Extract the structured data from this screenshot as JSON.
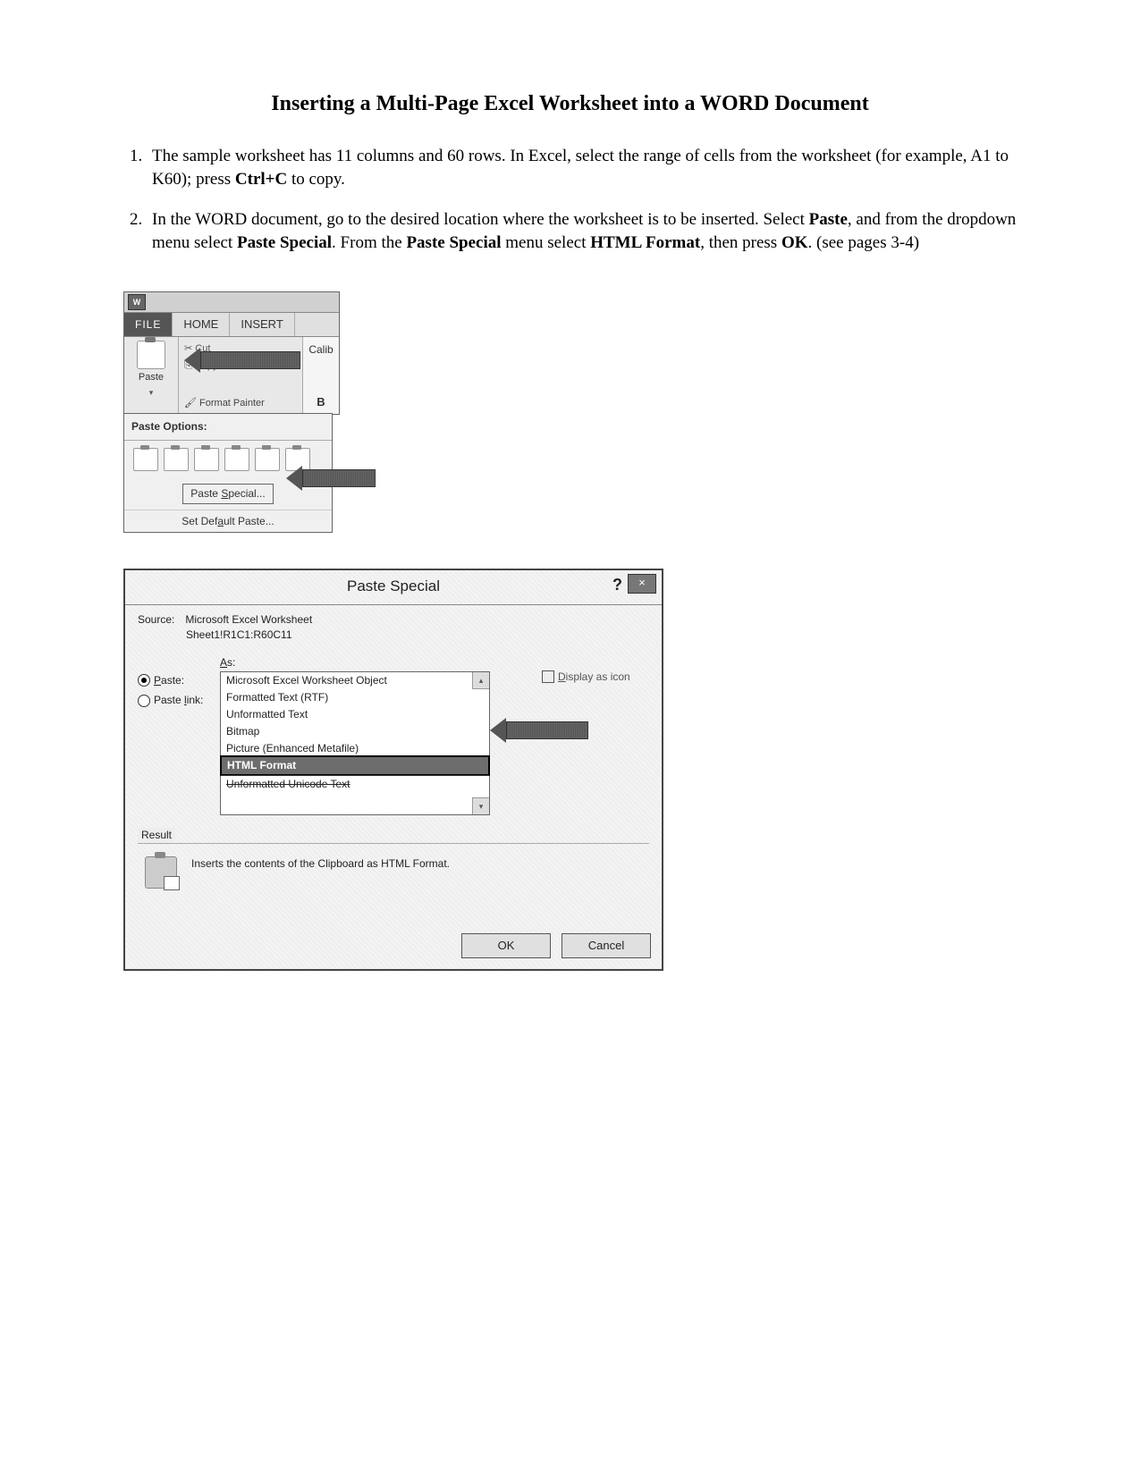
{
  "title": "Inserting a Multi-Page Excel Worksheet into a WORD Document",
  "steps": {
    "s1a": "The sample worksheet has 11 columns and 60 rows. In Excel, select the range of cells from the worksheet (for example, A1 to K60); press ",
    "s1b": "Ctrl+C",
    "s1c": " to copy.",
    "s2a": "In the WORD document, go to the desired location where the worksheet is to be inserted. Select ",
    "s2b": "Paste",
    "s2c": ", and from the dropdown menu select ",
    "s2d": "Paste Special",
    "s2e": ". From the ",
    "s2f": "Paste Special",
    "s2g": " menu select ",
    "s2h": "HTML Format",
    "s2i": ", then press ",
    "s2j": "OK",
    "s2k": ". (see pages 3-4)"
  },
  "ribbon": {
    "word_logo": "W",
    "file_tab": "FILE",
    "home_tab": "HOME",
    "insert_tab": "INSERT",
    "paste_label": "Paste",
    "cut": "Cut",
    "copy": "Copy",
    "format_painter": "Format Painter",
    "font_name": "Calib",
    "bold": "B",
    "dropdown_header": "Paste Options:",
    "paste_special": "Paste Special...",
    "set_default": "Set Default Paste..."
  },
  "dialog": {
    "title": "Paste Special",
    "help": "?",
    "close": "×",
    "source_lbl": "Source:",
    "source_val": "Microsoft Excel Worksheet",
    "source_line2": "Sheet1!R1C1:R60C11",
    "as_lbl": "As:",
    "radio_paste": "Paste:",
    "radio_link": "Paste link:",
    "options": {
      "o0": "Microsoft Excel Worksheet Object",
      "o1": "Formatted Text (RTF)",
      "o2": "Unformatted Text",
      "o3": "Bitmap",
      "o4": "Picture (Enhanced Metafile)",
      "o5": "HTML Format",
      "o6": "Unformatted Unicode Text"
    },
    "display_as_icon": "Display as icon",
    "result_lbl": "Result",
    "result_text": "Inserts the contents of the Clipboard as HTML Format.",
    "ok": "OK",
    "cancel": "Cancel"
  }
}
